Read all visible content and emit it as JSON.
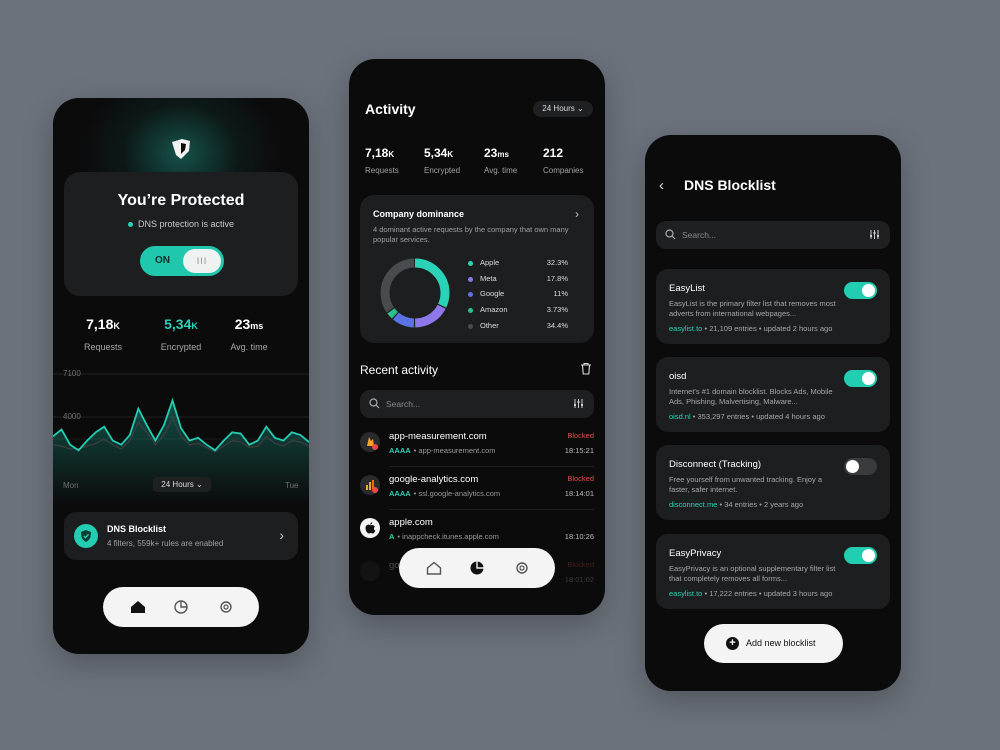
{
  "colors": {
    "accent": "#2ad3b7",
    "blocked": "#e84a4a",
    "background": "#6c727c"
  },
  "home": {
    "logo_icon": "app-logo-icon",
    "protect_title": "You’re Protected",
    "protect_status": "DNS protection is active",
    "toggle_label": "ON",
    "toggle_knob": "III",
    "stats": [
      {
        "value": "7,18",
        "unit": "K",
        "label": "Requests"
      },
      {
        "value": "5,34",
        "unit": "K",
        "label": "Encrypted"
      },
      {
        "value": "23",
        "unit": "ms",
        "label": "Avg. time"
      }
    ],
    "chart": {
      "y_ticks": [
        "7100",
        "4000"
      ],
      "x_start": "Mon",
      "x_end": "Tue",
      "range_select": "24 Hours ⌄"
    },
    "blocklist_card": {
      "title": "DNS Blocklist",
      "subtitle": "4 filters, 559k+ rules are enabled"
    },
    "nav": [
      "home-icon",
      "chart-icon",
      "gear-icon"
    ]
  },
  "chart_data": {
    "type": "area",
    "title": "",
    "xlabel": "",
    "ylabel": "",
    "x_range": [
      "Mon",
      "Tue"
    ],
    "y_ticks": [
      7100,
      4000
    ],
    "series": [
      {
        "values": [
          2600,
          3100,
          2000,
          1600,
          2300,
          2900,
          3300,
          2300,
          2000,
          2700,
          4600,
          3400,
          2300,
          3400,
          5200,
          3200,
          2300,
          2500,
          2000,
          1600,
          2300,
          2900,
          2800,
          2000,
          2300,
          3300,
          2500,
          2300,
          2900,
          2700,
          2200
        ]
      },
      {
        "values": [
          2000,
          1900,
          1700,
          1700,
          1900,
          2100,
          2400,
          2000,
          1700,
          2300,
          3600,
          2900,
          2000,
          2700,
          3900,
          2600,
          2000,
          2100,
          1800,
          1500,
          1900,
          2300,
          2200,
          1800,
          1900,
          2600,
          2100,
          1900,
          2300,
          2200,
          1900
        ]
      }
    ]
  },
  "activity": {
    "title": "Activity",
    "range_select": "24 Hours ⌄",
    "stats": [
      {
        "value": "7,18",
        "unit": "K",
        "label": "Requests"
      },
      {
        "value": "5,34",
        "unit": "K",
        "label": "Encrypted"
      },
      {
        "value": "23",
        "unit": "ms",
        "label": "Avg. time"
      },
      {
        "value": "212",
        "unit": "",
        "label": "Companies"
      }
    ],
    "dominance": {
      "title": "Company dominance",
      "desc": "4 dominant active requests by the company that own many popular services.",
      "items": [
        {
          "name": "Apple",
          "pct": "32.3%",
          "value": 32.3,
          "color": "#2ad3b7"
        },
        {
          "name": "Meta",
          "pct": "17.8%",
          "value": 17.8,
          "color": "#8e77e8"
        },
        {
          "name": "Google",
          "pct": "11%",
          "value": 11,
          "color": "#5b72e5"
        },
        {
          "name": "Amazon",
          "pct": "3.73%",
          "value": 3.73,
          "color": "#2bbf8a"
        },
        {
          "name": "Other",
          "pct": "34.4%",
          "value": 34.4,
          "color": "#4a4b4e"
        }
      ]
    },
    "recent_title": "Recent activity",
    "search_placeholder": "Search...",
    "rows": [
      {
        "domain": "app-measurement.com",
        "type": "AAAA",
        "sub": "app-measurement.com",
        "status": "Blocked",
        "time": "18:15:21",
        "icon": "firebase-icon"
      },
      {
        "domain": "google-analytics.com",
        "type": "AAAA",
        "sub": "ssl.google-analytics.com",
        "status": "Blocked",
        "time": "18:14:01",
        "icon": "analytics-icon"
      },
      {
        "domain": "apple.com",
        "type": "A",
        "sub": "inappcheck.itunes.apple.com",
        "status": "",
        "time": "18:10:26",
        "icon": "apple-icon"
      },
      {
        "domain": "go...",
        "type": "",
        "sub": "",
        "status": "Blocked",
        "time": "18:01:02",
        "icon": "analytics-icon"
      }
    ]
  },
  "blocklist": {
    "title": "DNS Blocklist",
    "search_placeholder": "Search...",
    "items": [
      {
        "name": "EasyList",
        "desc": "EasyList is the primary filter list that removes most adverts from international webpages...",
        "source": "easylist.to",
        "entries": "21,109 entries",
        "updated": "updated 2 hours ago",
        "enabled": true
      },
      {
        "name": "oisd",
        "desc": "Internet's #1 domain blocklist. Blocks Ads, Mobile Ads, Phishing, Malvertising, Malware...",
        "source": "oisd.nl",
        "entries": "353,297 entries",
        "updated": "updated 4 hours ago",
        "enabled": true
      },
      {
        "name": "Disconnect (Tracking)",
        "desc": "Free yourself from unwanted tracking. Enjoy a faster, safer internet.",
        "source": "disconnect.me",
        "entries": "34 entries",
        "updated": "2 years ago",
        "enabled": false
      },
      {
        "name": "EasyPrivacy",
        "desc": "EasyPrivacy is an optional supplementary filter list that completely removes all forms...",
        "source": "easylist.to",
        "entries": "17,222 entries",
        "updated": "updated 3 hours ago",
        "enabled": true
      }
    ],
    "add_button": "Add new blocklist",
    "separator": "•"
  }
}
